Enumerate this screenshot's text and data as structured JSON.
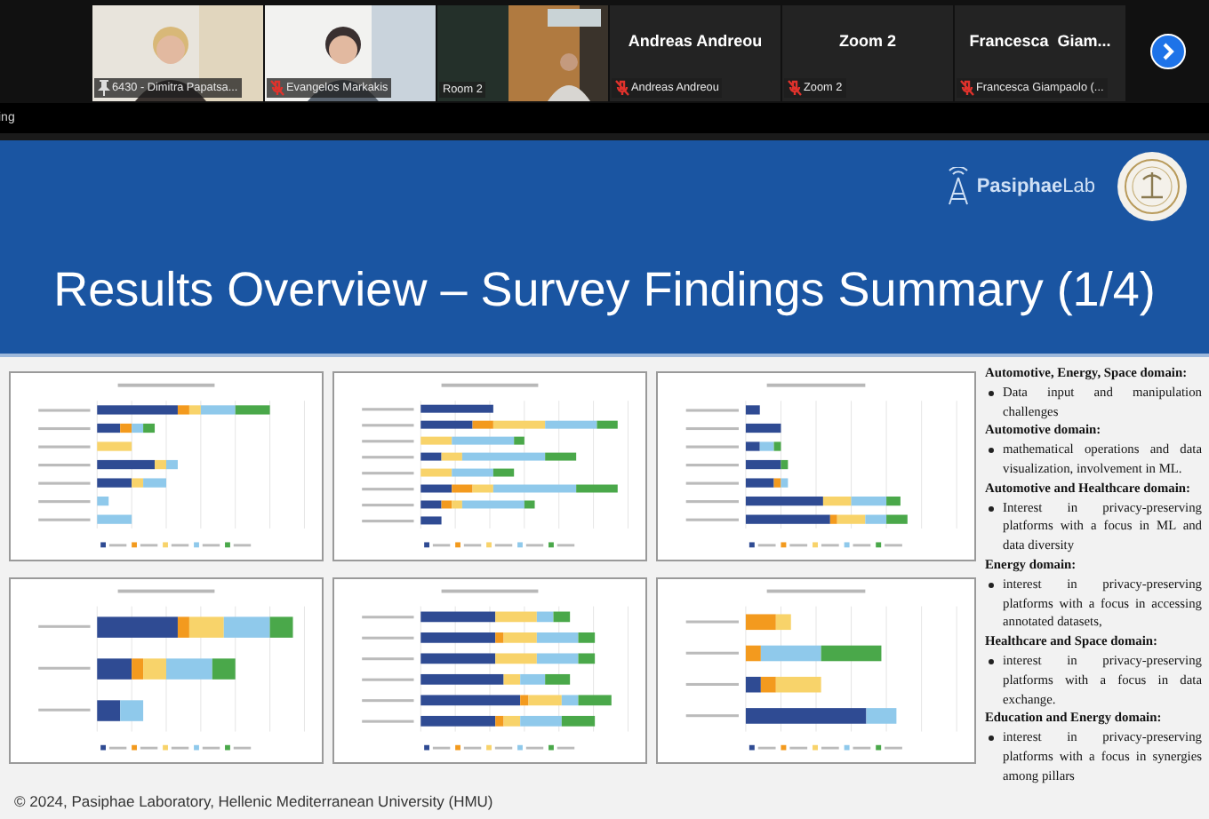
{
  "participants": [
    {
      "kind": "video",
      "label": "6430 - Dimitra Papatsa...",
      "pinned": true,
      "muted": false
    },
    {
      "kind": "video",
      "label": "Evangelos Markakis",
      "pinned": false,
      "muted": true
    },
    {
      "kind": "video",
      "label": "Room 2",
      "pinned": false,
      "muted": false
    },
    {
      "kind": "name",
      "name": "Andreas Andreou",
      "label": "Andreas Andreou",
      "pinned": false,
      "muted": true
    },
    {
      "kind": "name",
      "name": "Zoom 2",
      "label": "Zoom 2",
      "pinned": false,
      "muted": true
    },
    {
      "kind": "name",
      "name": "Francesca  Giam...",
      "label": "Francesca Giampaolo (...",
      "pinned": false,
      "muted": true
    }
  ],
  "status_text": "ing",
  "slide": {
    "logo_text": "**Pasiphae**Lab",
    "title": "Results Overview – Survey Findings Summary (1/4)",
    "findings": [
      {
        "heading": "Automotive, Energy, Space domain:",
        "items": [
          "Data input and manipulation challenges"
        ]
      },
      {
        "heading": "Automotive domain:",
        "items": [
          "mathematical operations and data visualization, involvement in ML."
        ]
      },
      {
        "heading": "Automotive and Healthcare domain:",
        "items": [
          "Interest in privacy-preserving platforms with a focus in ML and data diversity"
        ]
      },
      {
        "heading": "Energy domain:",
        "items": [
          "interest in privacy-preserving platforms with a focus in accessing annotated datasets,"
        ]
      },
      {
        "heading": "Healthcare and Space domain:",
        "items": [
          "interest in privacy-preserving platforms with a focus in data exchange."
        ]
      },
      {
        "heading": "Education and Energy domain:",
        "items": [
          "interest in privacy-preserving platforms with a focus in synergies among pillars"
        ]
      }
    ],
    "footer": "© 2024, Pasiphae Laboratory, Hellenic Mediterranean University (HMU)"
  }
}
